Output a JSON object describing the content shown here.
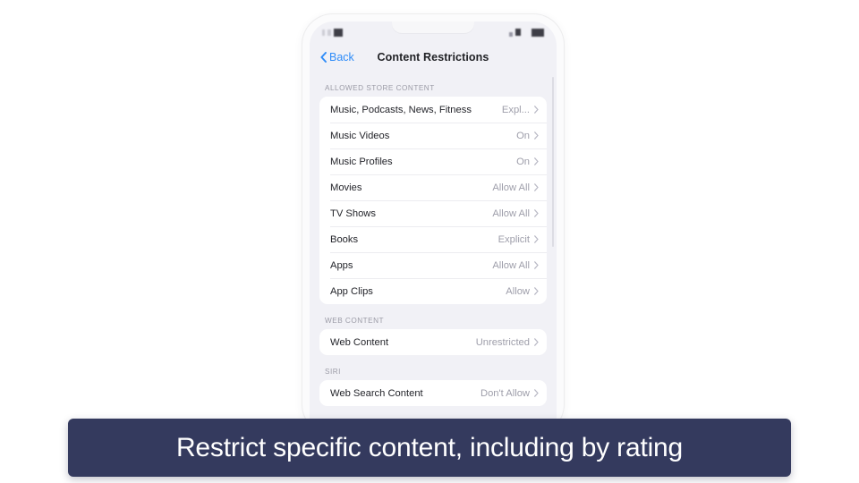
{
  "caption": {
    "text": "Restrict specific content, including by rating",
    "background_color": "#343a5e",
    "text_color": "#ffffff"
  },
  "phone": {
    "status_bar": {
      "time": "",
      "icons": [
        "signal-icon",
        "wifi-icon",
        "battery-icon"
      ],
      "note": "blurred"
    },
    "nav": {
      "back_label": "Back",
      "back_icon": "chevron-left-icon",
      "title": "Content Restrictions",
      "accent_color": "#2f8cf8"
    },
    "sections": [
      {
        "header": "ALLOWED STORE CONTENT",
        "rows": [
          {
            "label": "Music, Podcasts, News, Fitness",
            "value": "Expl...",
            "chevron": "chevron-right-icon"
          },
          {
            "label": "Music Videos",
            "value": "On",
            "chevron": "chevron-right-icon"
          },
          {
            "label": "Music Profiles",
            "value": "On",
            "chevron": "chevron-right-icon"
          },
          {
            "label": "Movies",
            "value": "Allow All",
            "chevron": "chevron-right-icon"
          },
          {
            "label": "TV Shows",
            "value": "Allow All",
            "chevron": "chevron-right-icon"
          },
          {
            "label": "Books",
            "value": "Explicit",
            "chevron": "chevron-right-icon"
          },
          {
            "label": "Apps",
            "value": "Allow All",
            "chevron": "chevron-right-icon"
          },
          {
            "label": "App Clips",
            "value": "Allow",
            "chevron": "chevron-right-icon"
          }
        ]
      },
      {
        "header": "WEB CONTENT",
        "rows": [
          {
            "label": "Web Content",
            "value": "Unrestricted",
            "chevron": "chevron-right-icon"
          }
        ]
      },
      {
        "header": "SIRI",
        "rows": [
          {
            "label": "Web Search Content",
            "value": "Don't Allow",
            "chevron": "chevron-right-icon"
          }
        ]
      }
    ]
  }
}
